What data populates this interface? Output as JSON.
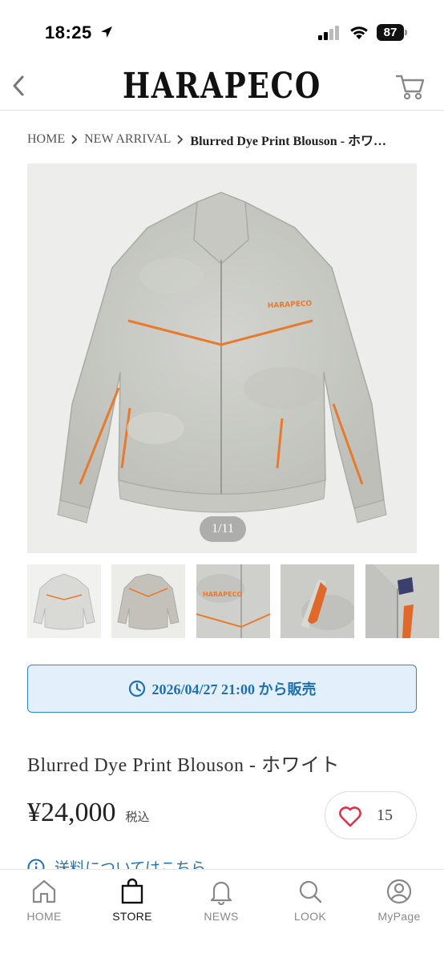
{
  "status_bar": {
    "time": "18:25",
    "battery": "87"
  },
  "header": {
    "logo": "HARAPECO"
  },
  "breadcrumb": {
    "items": [
      "HOME",
      "NEW ARRIVAL"
    ],
    "current": "Blurred Dye Print Blouson - ホワ…"
  },
  "gallery": {
    "counter": "1/11",
    "thumbnail_count": 5
  },
  "sale_notice": {
    "text": "2026/04/27 21:00 から販売"
  },
  "product": {
    "name": "Blurred Dye Print Blouson - ホワイト",
    "price": "¥24,000",
    "tax_label": "税込",
    "favorite_count": "15"
  },
  "shipping_link": {
    "text": "送料についてはこちら"
  },
  "tabbar": {
    "tabs": [
      {
        "label": "HOME",
        "icon": "home-icon"
      },
      {
        "label": "STORE",
        "icon": "shopping-bag-icon",
        "active": true
      },
      {
        "label": "NEWS",
        "icon": "bell-icon"
      },
      {
        "label": "LOOK",
        "icon": "search-icon"
      },
      {
        "label": "MyPage",
        "icon": "user-icon"
      }
    ]
  },
  "colors": {
    "accent_blue": "#1f6fae",
    "sale_bg": "#e3f0fb",
    "heart_red": "#d9344a"
  }
}
